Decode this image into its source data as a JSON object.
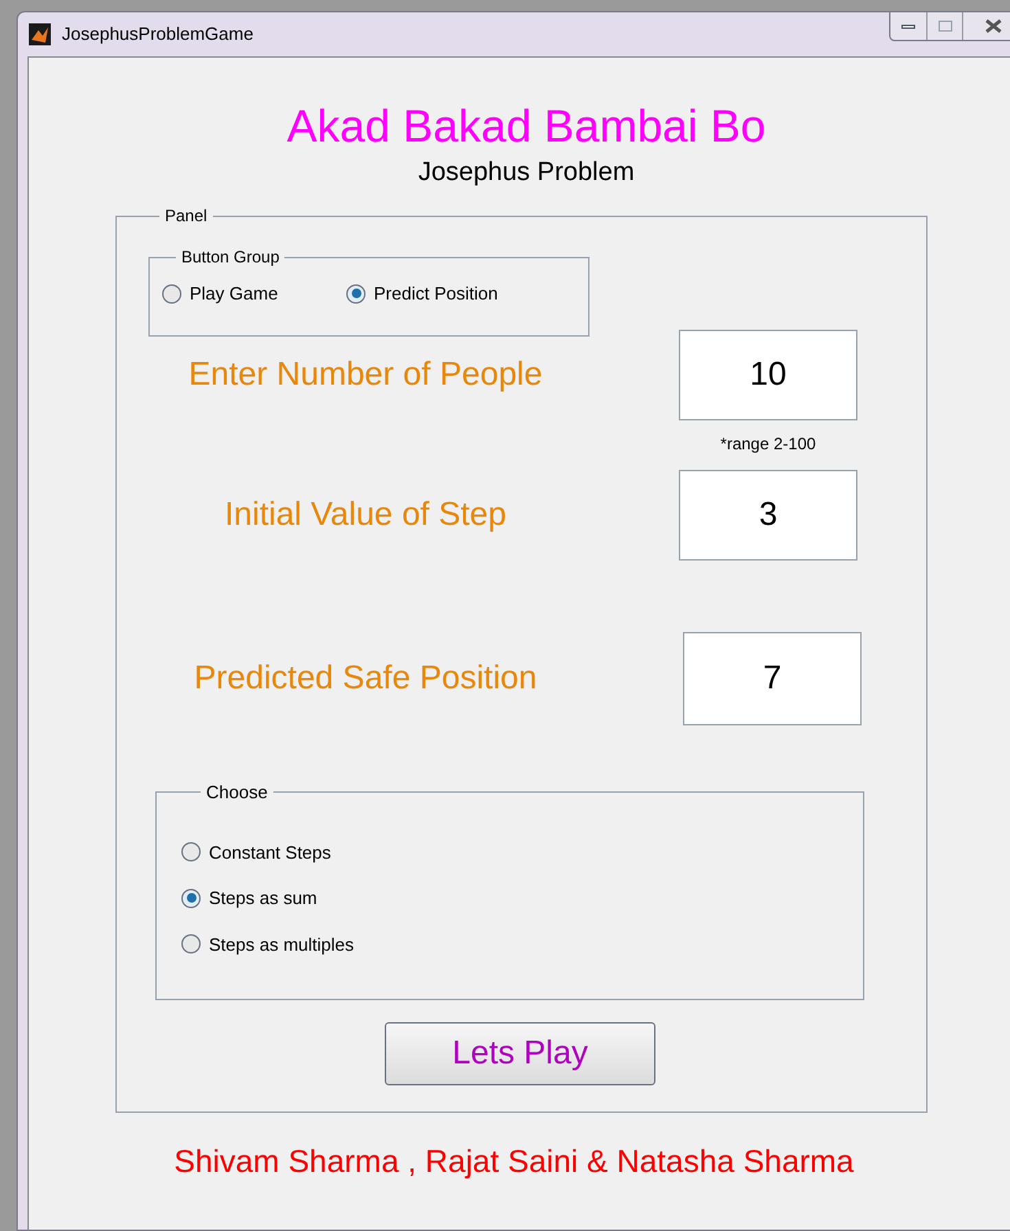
{
  "window": {
    "title": "JosephusProblemGame"
  },
  "title": "Akad Bakad Bambai Bo",
  "subtitle": "Josephus Problem",
  "panel": {
    "label": "Panel",
    "button_group": {
      "label": "Button Group",
      "options": [
        {
          "label": "Play Game",
          "selected": false
        },
        {
          "label": "Predict Position",
          "selected": true
        }
      ]
    },
    "fields": [
      {
        "label": "Enter Number of People",
        "value": "10",
        "hint": "*range 2-100"
      },
      {
        "label": "Initial Value of Step",
        "value": "3"
      },
      {
        "label": "Predicted Safe Position",
        "value": "7"
      }
    ],
    "choose": {
      "label": "Choose",
      "options": [
        {
          "label": "Constant Steps",
          "selected": false
        },
        {
          "label": "Steps as sum",
          "selected": true
        },
        {
          "label": "Steps as multiples",
          "selected": false
        }
      ]
    },
    "button": "Lets Play"
  },
  "footer": "Shivam Sharma , Rajat Saini & Natasha Sharma"
}
